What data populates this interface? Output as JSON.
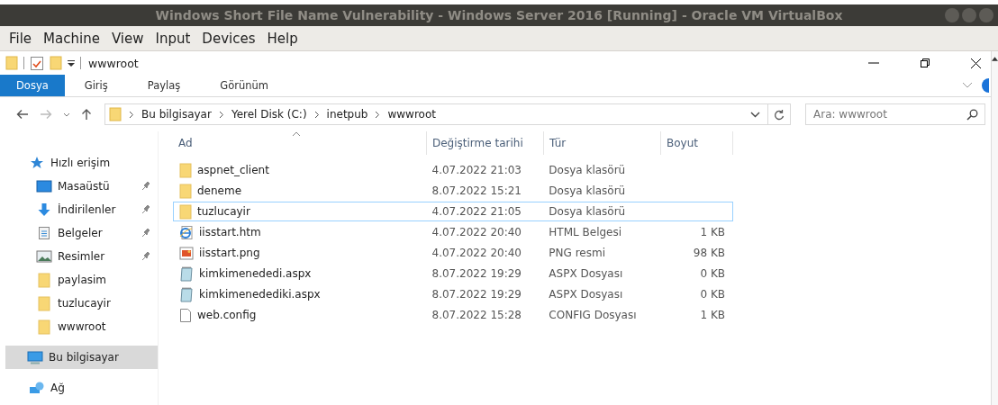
{
  "vm_window": {
    "title": "Windows Short File Name Vulnerability - Windows Server 2016 [Running] - Oracle VM VirtualBox"
  },
  "vm_menu": [
    "File",
    "Machine",
    "View",
    "Input",
    "Devices",
    "Help"
  ],
  "explorer": {
    "title": "wwwroot",
    "ribbon_tabs": [
      {
        "label": "Dosya",
        "selected": true
      },
      {
        "label": "Giriş",
        "selected": false
      },
      {
        "label": "Paylaş",
        "selected": false
      },
      {
        "label": "Görünüm",
        "selected": false
      }
    ],
    "breadcrumb": [
      "Bu bilgisayar",
      "Yerel Disk (C:)",
      "inetpub",
      "wwwroot"
    ],
    "search": {
      "placeholder": "Ara: wwwroot"
    },
    "nav": [
      {
        "label": "Hızlı erişim",
        "kind": "star",
        "selected": false,
        "children": [
          {
            "label": "Masaüstü",
            "kind": "desktop",
            "pinned": true,
            "selected": false
          },
          {
            "label": "İndirilenler",
            "kind": "download",
            "pinned": true,
            "selected": false
          },
          {
            "label": "Belgeler",
            "kind": "documents",
            "pinned": true,
            "selected": false
          },
          {
            "label": "Resimler",
            "kind": "pictures",
            "pinned": true,
            "selected": false
          },
          {
            "label": "paylasim",
            "kind": "folder",
            "pinned": false,
            "selected": false
          },
          {
            "label": "tuzlucayir",
            "kind": "folder",
            "pinned": false,
            "selected": false
          },
          {
            "label": "wwwroot",
            "kind": "folder",
            "pinned": false,
            "selected": false
          }
        ]
      },
      {
        "label": "Bu bilgisayar",
        "kind": "pc",
        "selected": true
      },
      {
        "label": "Ağ",
        "kind": "network",
        "selected": false
      }
    ],
    "columns": [
      "Ad",
      "Değiştirme tarihi",
      "Tür",
      "Boyut"
    ],
    "rows": [
      {
        "name": "aspnet_client",
        "date": "4.07.2022 21:03",
        "type": "Dosya klasörü",
        "kind": "folder",
        "focused": false
      },
      {
        "name": "deneme",
        "date": "8.07.2022 15:21",
        "type": "Dosya klasörü",
        "kind": "folder",
        "focused": false
      },
      {
        "name": "tuzlucayir",
        "date": "4.07.2022 21:05",
        "type": "Dosya klasörü",
        "kind": "folder",
        "focused": true
      },
      {
        "name": "iisstart.htm",
        "date": "4.07.2022 20:40",
        "type": "HTML Belgesi",
        "size": "1 KB",
        "kind": "html",
        "focused": false
      },
      {
        "name": "iisstart.png",
        "date": "4.07.2022 20:40",
        "type": "PNG resmi",
        "size": "98 KB",
        "kind": "png",
        "focused": false
      },
      {
        "name": "kimkimenededi.aspx",
        "date": "8.07.2022 19:29",
        "type": "ASPX Dosyası",
        "size": "0 KB",
        "kind": "aspx",
        "focused": false
      },
      {
        "name": "kimkimenedediki.aspx",
        "date": "8.07.2022 19:29",
        "type": "ASPX Dosyası",
        "size": "0 KB",
        "kind": "aspx",
        "focused": false
      },
      {
        "name": "web.config",
        "date": "8.07.2022 15:28",
        "type": "CONFIG Dosyası",
        "size": "1 KB",
        "kind": "config",
        "focused": false
      }
    ]
  }
}
